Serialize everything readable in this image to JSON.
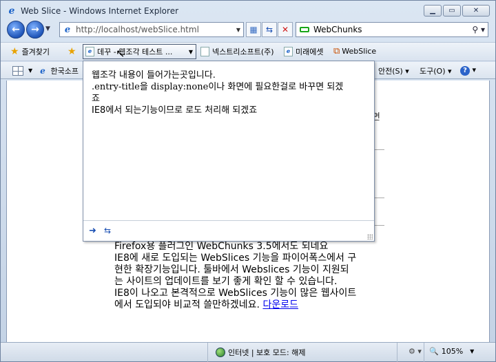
{
  "window": {
    "title": "Web Slice - Windows Internet Explorer",
    "controls": {
      "minimize": "▁",
      "maximize": "▭",
      "close": "✕"
    }
  },
  "address": {
    "url": "http://localhost/webSlice.html"
  },
  "search": {
    "provider": "WebChunks"
  },
  "favorites_bar": {
    "favorites_label": "즐겨찾기",
    "slice_label": "데꾸 - 웹조각 테스트 ...",
    "items": [
      {
        "label": "넥스트리소프트(주)"
      },
      {
        "label": "미래에셋"
      },
      {
        "label": "WebSlice"
      }
    ]
  },
  "command_bar": {
    "tab_label": "한국소프",
    "safety": "안전(S)",
    "tools": "도구(O)",
    "help": "?"
  },
  "popup": {
    "line1": "웹조각 내용이 들어가는곳입니다.",
    "line2a": ".entry-title",
    "line2b": "을 ",
    "line2c": "display:none",
    "line2d": "이나 화면에 필요한걸로 바꾸면 되겠",
    "line3": "죠",
    "line4": "IE8에서 되는기능이므로 로도 처리해 되겠죠"
  },
  "content": {
    "line1": "Firefox용 플러그인 WebChunks 3.5에서도 되네요",
    "line2": "IE8에 새로 도입되는 WebSlices 기능을 파이어폭스에서 구",
    "line3": "현한 확장기능입니다. 툴바에서 Webslices 기능이 지원되",
    "line4": "는 사이트의 업데이트를 보기 좋게 확인 할 수 있습니다.",
    "line5": "IE8이 나오고 본격적으로 WebSlices 기능이 많은 웹사이트",
    "line6_text": "에서 도입되야 비교적 쓸만하겠네요. ",
    "line6_link": "다운로드",
    "behind_fragment": "면"
  },
  "status": {
    "zone": "인터넷 | 보호 모드: 해제",
    "zoom": "105%"
  }
}
